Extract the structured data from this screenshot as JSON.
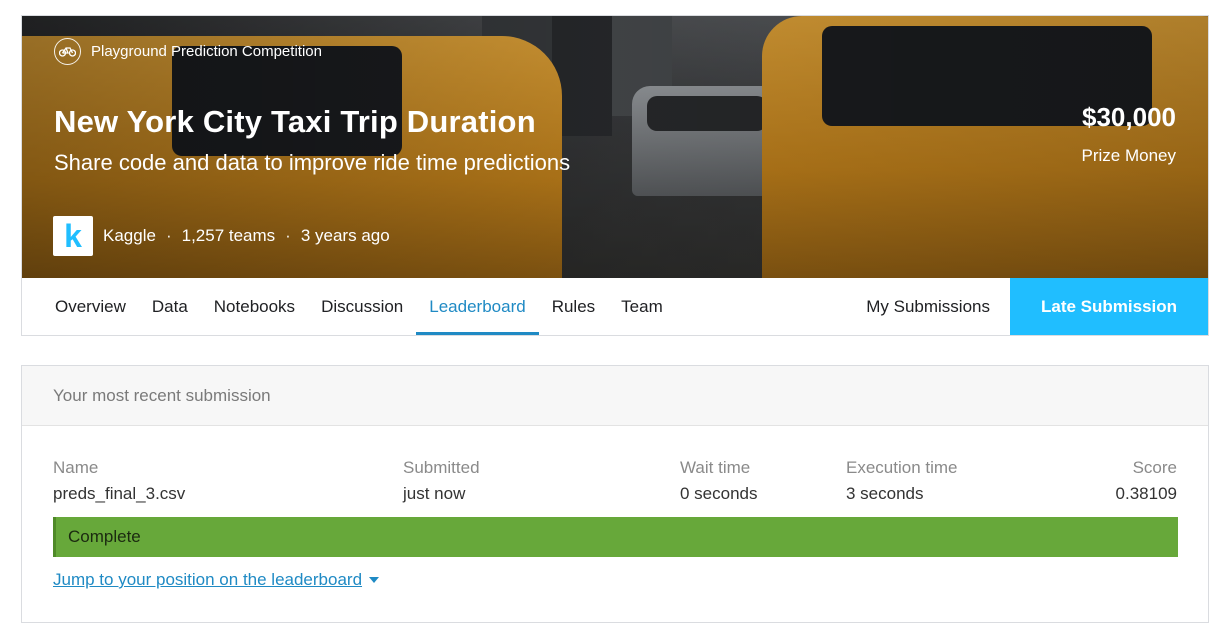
{
  "competition": {
    "type_label": "Playground Prediction Competition",
    "title": "New York City Taxi Trip Duration",
    "subtitle": "Share code and data to improve ride time predictions",
    "prize_amount": "$30,000",
    "prize_label": "Prize Money",
    "host": "Kaggle",
    "teams": "1,257 teams",
    "age": "3 years ago",
    "logo_letter": "k",
    "separator": "·"
  },
  "tabs": [
    {
      "label": "Overview",
      "active": false
    },
    {
      "label": "Data",
      "active": false
    },
    {
      "label": "Notebooks",
      "active": false
    },
    {
      "label": "Discussion",
      "active": false
    },
    {
      "label": "Leaderboard",
      "active": true
    },
    {
      "label": "Rules",
      "active": false
    },
    {
      "label": "Team",
      "active": false
    }
  ],
  "actions": {
    "my_submissions": "My Submissions",
    "late_submission": "Late Submission"
  },
  "submission": {
    "heading": "Your most recent submission",
    "columns": {
      "name": {
        "label": "Name",
        "value": "preds_final_3.csv"
      },
      "submitted": {
        "label": "Submitted",
        "value": "just now"
      },
      "wait_time": {
        "label": "Wait time",
        "value": "0 seconds"
      },
      "execution_time": {
        "label": "Execution time",
        "value": "3 seconds"
      },
      "score": {
        "label": "Score",
        "value": "0.38109"
      }
    },
    "status": "Complete",
    "jump_link": "Jump to your position on the leaderboard"
  },
  "colors": {
    "accent": "#20beff",
    "active_tab": "#1f8ac4",
    "status_complete": "#67a83a"
  },
  "icons": [
    "bicycle-icon",
    "kaggle-logo",
    "caret-down-icon"
  ]
}
